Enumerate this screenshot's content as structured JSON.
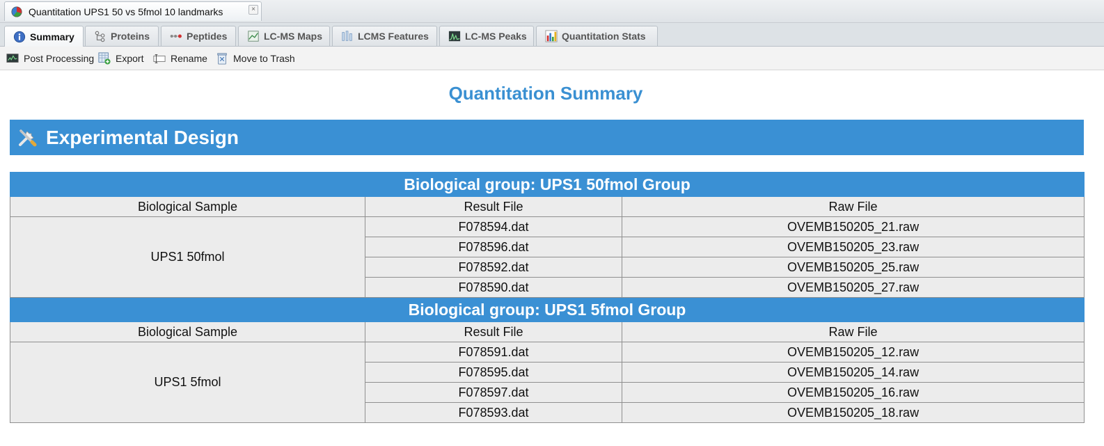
{
  "window_tab": {
    "title": "Quantitation UPS1 50 vs 5fmol 10 landmarks",
    "icon": "pie-chart-icon",
    "close_label": "×"
  },
  "tabs": [
    {
      "label": "Summary",
      "icon": "info-icon",
      "active": true
    },
    {
      "label": "Proteins",
      "icon": "tree-icon",
      "active": false
    },
    {
      "label": "Peptides",
      "icon": "peptide-icon",
      "active": false
    },
    {
      "label": "LC-MS Maps",
      "icon": "map-icon",
      "active": false
    },
    {
      "label": "LCMS Features",
      "icon": "features-icon",
      "active": false
    },
    {
      "label": "LC-MS Peaks",
      "icon": "peaks-icon",
      "active": false
    },
    {
      "label": "Quantitation Stats",
      "icon": "bar-chart-icon",
      "active": false
    }
  ],
  "toolbar": {
    "post_processing": "Post Processing",
    "export": "Export",
    "rename": "Rename",
    "move_to_trash": "Move to Trash"
  },
  "page_title": "Quantitation Summary",
  "section": {
    "title": "Experimental Design",
    "icon": "tools-icon"
  },
  "colors": {
    "accent": "#3a90d4",
    "title_blue": "#3a90d2"
  },
  "columns": [
    "Biological Sample",
    "Result File",
    "Raw File"
  ],
  "groups": [
    {
      "title": "Biological group: UPS1 50fmol Group",
      "sample": "UPS1 50fmol",
      "rows": [
        {
          "result": "F078594.dat",
          "raw": "OVEMB150205_21.raw"
        },
        {
          "result": "F078596.dat",
          "raw": "OVEMB150205_23.raw"
        },
        {
          "result": "F078592.dat",
          "raw": "OVEMB150205_25.raw"
        },
        {
          "result": "F078590.dat",
          "raw": "OVEMB150205_27.raw"
        }
      ]
    },
    {
      "title": "Biological group: UPS1 5fmol Group",
      "sample": "UPS1 5fmol",
      "rows": [
        {
          "result": "F078591.dat",
          "raw": "OVEMB150205_12.raw"
        },
        {
          "result": "F078595.dat",
          "raw": "OVEMB150205_14.raw"
        },
        {
          "result": "F078597.dat",
          "raw": "OVEMB150205_16.raw"
        },
        {
          "result": "F078593.dat",
          "raw": "OVEMB150205_18.raw"
        }
      ]
    }
  ]
}
